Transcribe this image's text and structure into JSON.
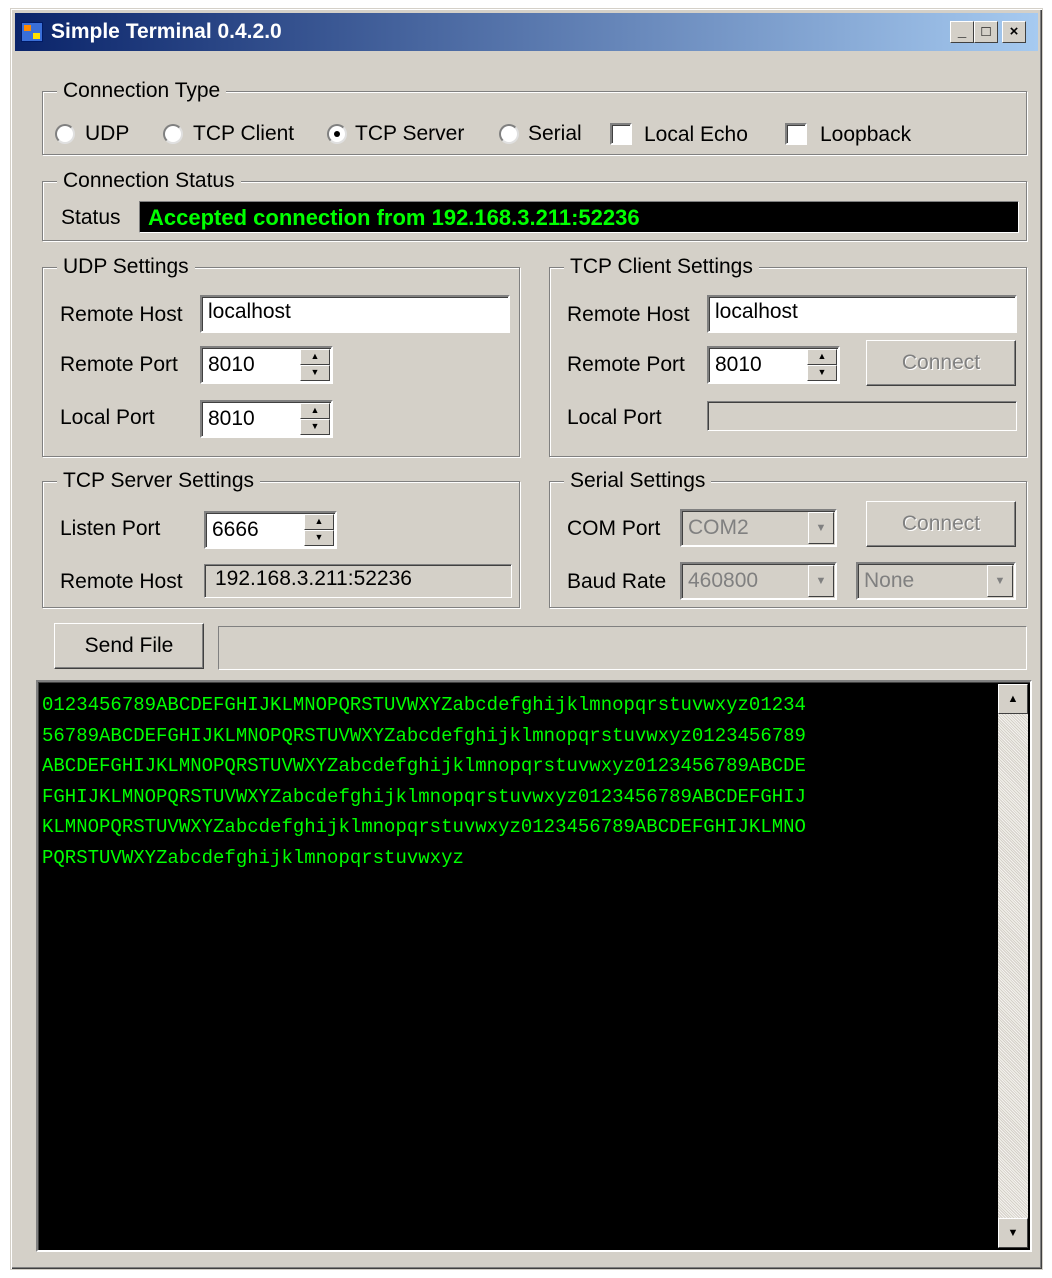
{
  "window": {
    "title": "Simple Terminal 0.4.2.0"
  },
  "titlebar_buttons": {
    "minimize": "_",
    "maximize": "□",
    "close": "×"
  },
  "connection_type": {
    "legend": "Connection Type",
    "udp": "UDP",
    "tcp_client": "TCP Client",
    "tcp_server": "TCP Server",
    "serial": "Serial",
    "local_echo": "Local Echo",
    "loopback": "Loopback",
    "selected": "TCP Server"
  },
  "connection_status": {
    "legend": "Connection Status",
    "label": "Status",
    "value": "Accepted connection from 192.168.3.211:52236",
    "value_color": "#00ff00"
  },
  "udp_settings": {
    "legend": "UDP Settings",
    "remote_host_label": "Remote Host",
    "remote_host": "localhost",
    "remote_port_label": "Remote Port",
    "remote_port": "8010",
    "local_port_label": "Local Port",
    "local_port": "8010"
  },
  "tcp_client_settings": {
    "legend": "TCP Client Settings",
    "remote_host_label": "Remote Host",
    "remote_host": "localhost",
    "remote_port_label": "Remote Port",
    "remote_port": "8010",
    "connect_label": "Connect",
    "local_port_label": "Local Port",
    "local_port": ""
  },
  "tcp_server_settings": {
    "legend": "TCP Server Settings",
    "listen_port_label": "Listen Port",
    "listen_port": "6666",
    "remote_host_label": "Remote Host",
    "remote_host": "192.168.3.211:52236"
  },
  "serial_settings": {
    "legend": "Serial Settings",
    "com_port_label": "COM Port",
    "com_port": "COM2",
    "connect_label": "Connect",
    "baud_rate_label": "Baud Rate",
    "baud_rate": "460800",
    "parity": "None"
  },
  "send_file": {
    "label": "Send File"
  },
  "terminal": {
    "text": "0123456789ABCDEFGHIJKLMNOPQRSTUVWXYZabcdefghijklmnopqrstuvwxyz01234\n56789ABCDEFGHIJKLMNOPQRSTUVWXYZabcdefghijklmnopqrstuvwxyz0123456789\nABCDEFGHIJKLMNOPQRSTUVWXYZabcdefghijklmnopqrstuvwxyz0123456789ABCDE\nFGHIJKLMNOPQRSTUVWXYZabcdefghijklmnopqrstuvwxyz0123456789ABCDEFGHIJ\nKLMNOPQRSTUVWXYZabcdefghijklmnopqrstuvwxyz0123456789ABCDEFGHIJKLMNO\nPQRSTUVWXYZabcdefghijklmnopqrstuvwxyz",
    "text_color": "#00ff00",
    "background": "#000000"
  },
  "icons": {
    "app": "app-icon",
    "scroll_up": "▲",
    "scroll_down": "▼",
    "spin_up": "▲",
    "spin_down": "▼",
    "dropdown": "▼"
  }
}
